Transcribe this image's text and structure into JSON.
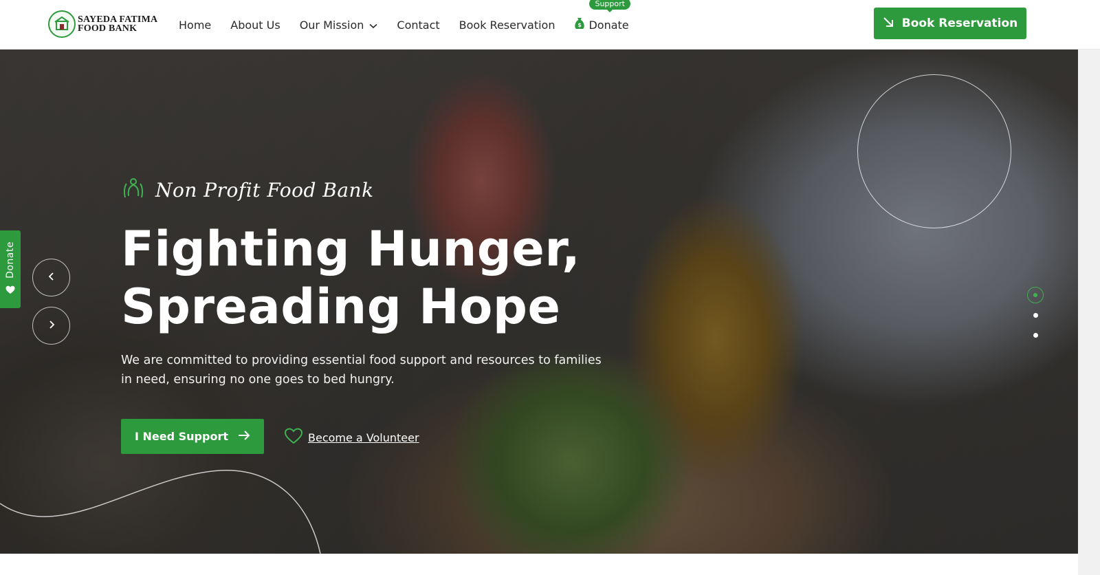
{
  "header": {
    "logo": {
      "line1": "SAYEDA FATIMA",
      "line2": "FOOD BANK"
    },
    "nav": [
      {
        "label": "Home"
      },
      {
        "label": "About Us"
      },
      {
        "label": "Our Mission",
        "dropdown": true
      },
      {
        "label": "Contact"
      },
      {
        "label": "Book Reservation"
      }
    ],
    "donate": {
      "label": "Donate",
      "badge": "Support",
      "icon": "money-bag-icon"
    },
    "cta": {
      "label": "Book Reservation",
      "icon": "arrow-down-right-icon"
    }
  },
  "hero": {
    "tagline": "Non Profit Food Bank",
    "headline_line1": "Fighting Hunger,",
    "headline_line2": "Spreading Hope",
    "subtext": "We are committed to providing essential food support and resources to families in need, ensuring no one goes to bed hungry.",
    "primary_button": {
      "label": "I Need Support",
      "icon": "arrow-right-icon"
    },
    "secondary_link": {
      "label": "Become a Volunteer",
      "icon": "heart-outline-icon"
    },
    "slider": {
      "prev_icon": "chevron-left-icon",
      "next_icon": "chevron-right-icon",
      "total_slides": 3,
      "active_slide": 1
    }
  },
  "side_tab": {
    "label": "Donate",
    "icon": "heart-icon"
  },
  "colors": {
    "brand_green": "#2e9a3e",
    "accent_green": "#3fb152",
    "text_dark": "#2a2a2a",
    "white": "#ffffff"
  }
}
